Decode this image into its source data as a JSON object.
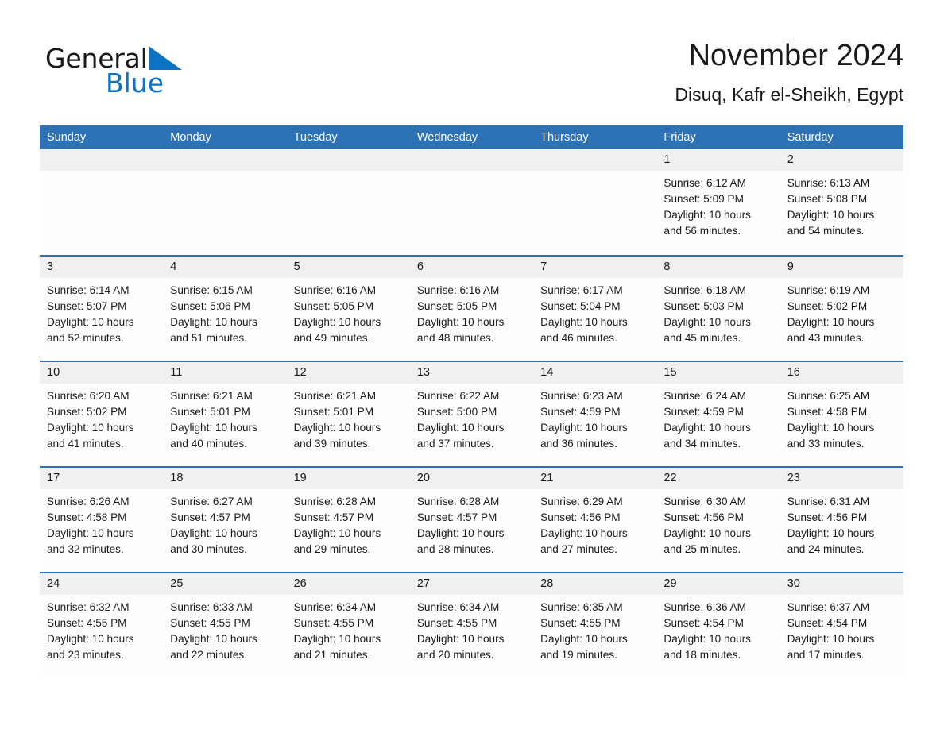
{
  "brand": {
    "name_part1": "General",
    "name_part2": "Blue",
    "logo_icon": "triangle-logo-icon",
    "accent_color": "#0b72c4"
  },
  "header": {
    "month_title": "November 2024",
    "location": "Disuq, Kafr el-Sheikh, Egypt"
  },
  "theme": {
    "header_blue": "#2c72b4",
    "day_band_gray": "#f0f0f0",
    "cell_white": "#fdfdfd",
    "text_black": "#1a1a1a"
  },
  "calendar": {
    "weekdays": [
      "Sunday",
      "Monday",
      "Tuesday",
      "Wednesday",
      "Thursday",
      "Friday",
      "Saturday"
    ],
    "weeks": [
      [
        {
          "day": "",
          "lines": []
        },
        {
          "day": "",
          "lines": []
        },
        {
          "day": "",
          "lines": []
        },
        {
          "day": "",
          "lines": []
        },
        {
          "day": "",
          "lines": []
        },
        {
          "day": "1",
          "lines": [
            "Sunrise: 6:12 AM",
            "Sunset: 5:09 PM",
            "Daylight: 10 hours",
            "and 56 minutes."
          ]
        },
        {
          "day": "2",
          "lines": [
            "Sunrise: 6:13 AM",
            "Sunset: 5:08 PM",
            "Daylight: 10 hours",
            "and 54 minutes."
          ]
        }
      ],
      [
        {
          "day": "3",
          "lines": [
            "Sunrise: 6:14 AM",
            "Sunset: 5:07 PM",
            "Daylight: 10 hours",
            "and 52 minutes."
          ]
        },
        {
          "day": "4",
          "lines": [
            "Sunrise: 6:15 AM",
            "Sunset: 5:06 PM",
            "Daylight: 10 hours",
            "and 51 minutes."
          ]
        },
        {
          "day": "5",
          "lines": [
            "Sunrise: 6:16 AM",
            "Sunset: 5:05 PM",
            "Daylight: 10 hours",
            "and 49 minutes."
          ]
        },
        {
          "day": "6",
          "lines": [
            "Sunrise: 6:16 AM",
            "Sunset: 5:05 PM",
            "Daylight: 10 hours",
            "and 48 minutes."
          ]
        },
        {
          "day": "7",
          "lines": [
            "Sunrise: 6:17 AM",
            "Sunset: 5:04 PM",
            "Daylight: 10 hours",
            "and 46 minutes."
          ]
        },
        {
          "day": "8",
          "lines": [
            "Sunrise: 6:18 AM",
            "Sunset: 5:03 PM",
            "Daylight: 10 hours",
            "and 45 minutes."
          ]
        },
        {
          "day": "9",
          "lines": [
            "Sunrise: 6:19 AM",
            "Sunset: 5:02 PM",
            "Daylight: 10 hours",
            "and 43 minutes."
          ]
        }
      ],
      [
        {
          "day": "10",
          "lines": [
            "Sunrise: 6:20 AM",
            "Sunset: 5:02 PM",
            "Daylight: 10 hours",
            "and 41 minutes."
          ]
        },
        {
          "day": "11",
          "lines": [
            "Sunrise: 6:21 AM",
            "Sunset: 5:01 PM",
            "Daylight: 10 hours",
            "and 40 minutes."
          ]
        },
        {
          "day": "12",
          "lines": [
            "Sunrise: 6:21 AM",
            "Sunset: 5:01 PM",
            "Daylight: 10 hours",
            "and 39 minutes."
          ]
        },
        {
          "day": "13",
          "lines": [
            "Sunrise: 6:22 AM",
            "Sunset: 5:00 PM",
            "Daylight: 10 hours",
            "and 37 minutes."
          ]
        },
        {
          "day": "14",
          "lines": [
            "Sunrise: 6:23 AM",
            "Sunset: 4:59 PM",
            "Daylight: 10 hours",
            "and 36 minutes."
          ]
        },
        {
          "day": "15",
          "lines": [
            "Sunrise: 6:24 AM",
            "Sunset: 4:59 PM",
            "Daylight: 10 hours",
            "and 34 minutes."
          ]
        },
        {
          "day": "16",
          "lines": [
            "Sunrise: 6:25 AM",
            "Sunset: 4:58 PM",
            "Daylight: 10 hours",
            "and 33 minutes."
          ]
        }
      ],
      [
        {
          "day": "17",
          "lines": [
            "Sunrise: 6:26 AM",
            "Sunset: 4:58 PM",
            "Daylight: 10 hours",
            "and 32 minutes."
          ]
        },
        {
          "day": "18",
          "lines": [
            "Sunrise: 6:27 AM",
            "Sunset: 4:57 PM",
            "Daylight: 10 hours",
            "and 30 minutes."
          ]
        },
        {
          "day": "19",
          "lines": [
            "Sunrise: 6:28 AM",
            "Sunset: 4:57 PM",
            "Daylight: 10 hours",
            "and 29 minutes."
          ]
        },
        {
          "day": "20",
          "lines": [
            "Sunrise: 6:28 AM",
            "Sunset: 4:57 PM",
            "Daylight: 10 hours",
            "and 28 minutes."
          ]
        },
        {
          "day": "21",
          "lines": [
            "Sunrise: 6:29 AM",
            "Sunset: 4:56 PM",
            "Daylight: 10 hours",
            "and 27 minutes."
          ]
        },
        {
          "day": "22",
          "lines": [
            "Sunrise: 6:30 AM",
            "Sunset: 4:56 PM",
            "Daylight: 10 hours",
            "and 25 minutes."
          ]
        },
        {
          "day": "23",
          "lines": [
            "Sunrise: 6:31 AM",
            "Sunset: 4:56 PM",
            "Daylight: 10 hours",
            "and 24 minutes."
          ]
        }
      ],
      [
        {
          "day": "24",
          "lines": [
            "Sunrise: 6:32 AM",
            "Sunset: 4:55 PM",
            "Daylight: 10 hours",
            "and 23 minutes."
          ]
        },
        {
          "day": "25",
          "lines": [
            "Sunrise: 6:33 AM",
            "Sunset: 4:55 PM",
            "Daylight: 10 hours",
            "and 22 minutes."
          ]
        },
        {
          "day": "26",
          "lines": [
            "Sunrise: 6:34 AM",
            "Sunset: 4:55 PM",
            "Daylight: 10 hours",
            "and 21 minutes."
          ]
        },
        {
          "day": "27",
          "lines": [
            "Sunrise: 6:34 AM",
            "Sunset: 4:55 PM",
            "Daylight: 10 hours",
            "and 20 minutes."
          ]
        },
        {
          "day": "28",
          "lines": [
            "Sunrise: 6:35 AM",
            "Sunset: 4:55 PM",
            "Daylight: 10 hours",
            "and 19 minutes."
          ]
        },
        {
          "day": "29",
          "lines": [
            "Sunrise: 6:36 AM",
            "Sunset: 4:54 PM",
            "Daylight: 10 hours",
            "and 18 minutes."
          ]
        },
        {
          "day": "30",
          "lines": [
            "Sunrise: 6:37 AM",
            "Sunset: 4:54 PM",
            "Daylight: 10 hours",
            "and 17 minutes."
          ]
        }
      ]
    ]
  }
}
